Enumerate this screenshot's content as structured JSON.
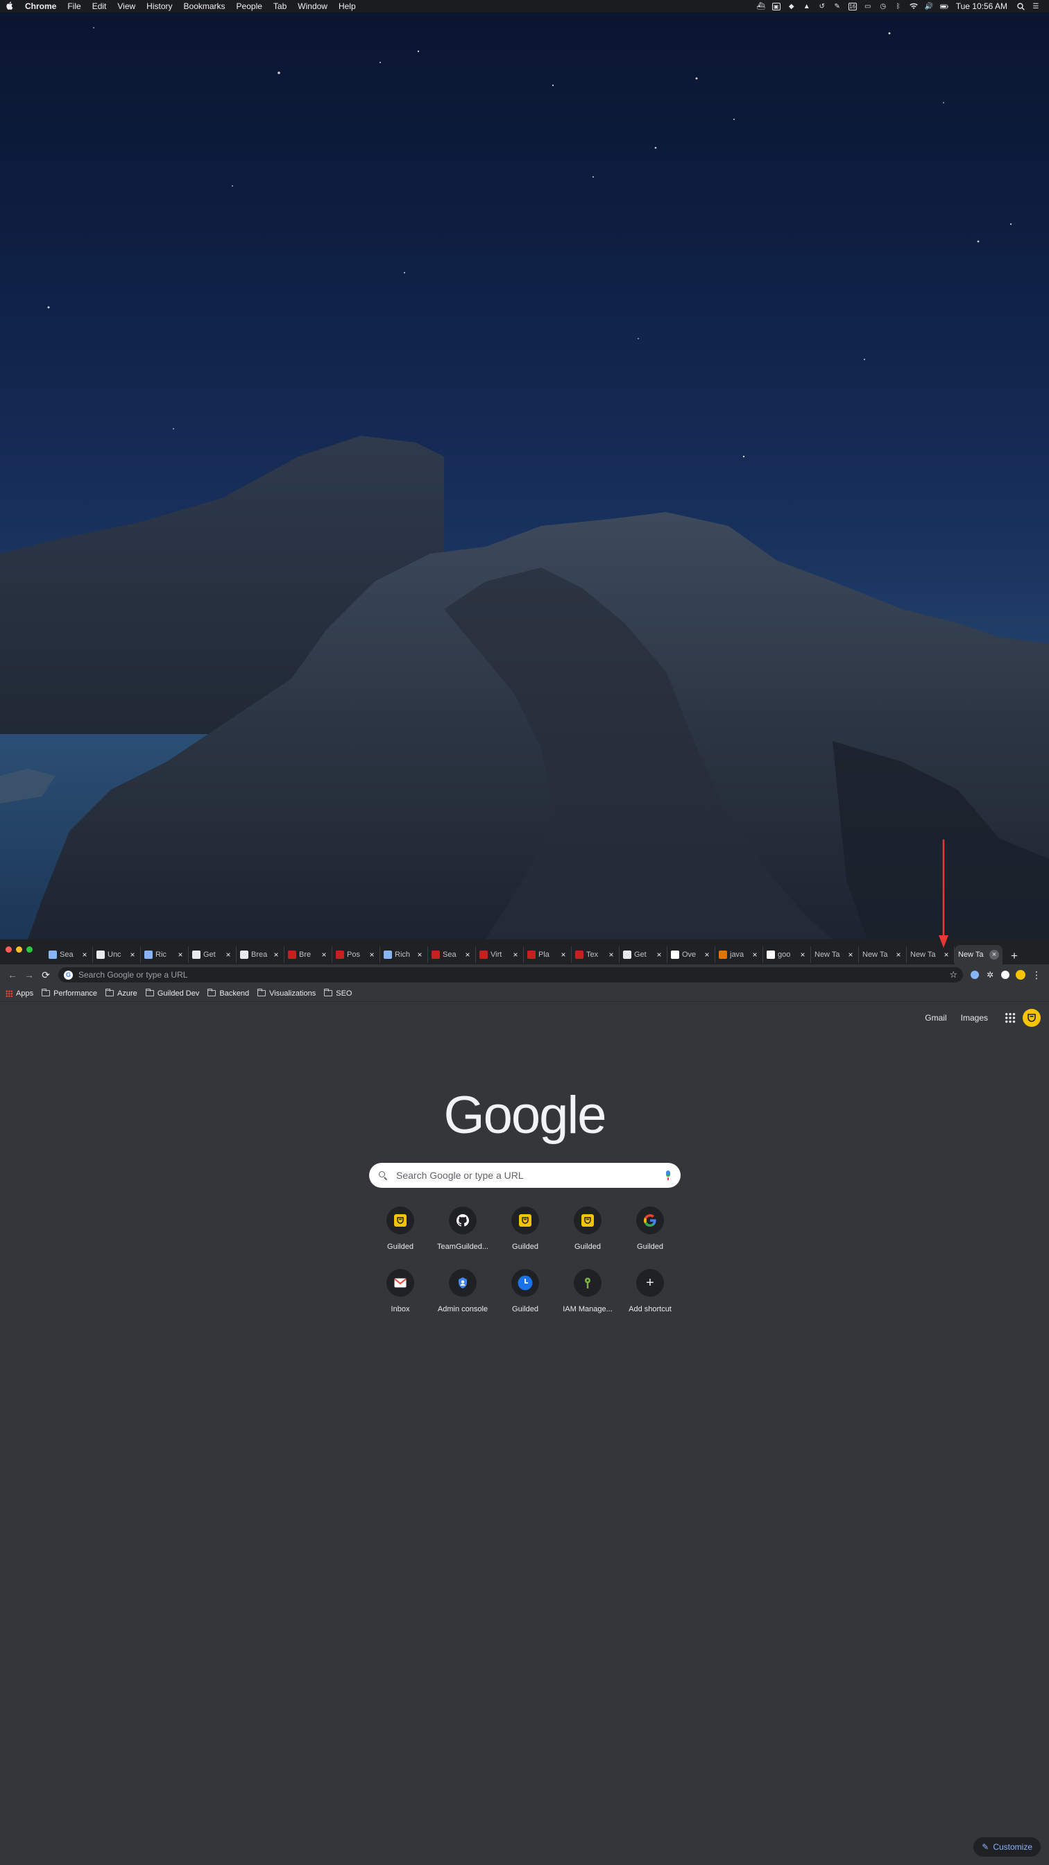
{
  "menubar": {
    "apple": "",
    "items": [
      {
        "label": "Chrome",
        "bold": true
      },
      {
        "label": "File"
      },
      {
        "label": "Edit"
      },
      {
        "label": "View"
      },
      {
        "label": "History"
      },
      {
        "label": "Bookmarks"
      },
      {
        "label": "People"
      },
      {
        "label": "Tab"
      },
      {
        "label": "Window"
      },
      {
        "label": "Help"
      }
    ],
    "status_badge": "16",
    "clock": "Tue 10:56 AM"
  },
  "tabs": [
    {
      "title": "Sea",
      "favicon": "#8ab4f8"
    },
    {
      "title": "Unc",
      "favicon": "#e8eaed"
    },
    {
      "title": "Ric",
      "favicon": "#8ab4f8"
    },
    {
      "title": "Get",
      "favicon": "#e8eaed"
    },
    {
      "title": "Brea",
      "favicon": "#e8eaed"
    },
    {
      "title": "Bre",
      "favicon": "#c5221f"
    },
    {
      "title": "Pos",
      "favicon": "#c5221f"
    },
    {
      "title": "Rich",
      "favicon": "#8ab4f8"
    },
    {
      "title": "Sea",
      "favicon": "#c5221f"
    },
    {
      "title": "Virt",
      "favicon": "#c5221f"
    },
    {
      "title": "Pla",
      "favicon": "#c5221f"
    },
    {
      "title": "Tex",
      "favicon": "#c5221f"
    },
    {
      "title": "Get",
      "favicon": "#e8eaed"
    },
    {
      "title": "Ove",
      "favicon": "#ffffff"
    },
    {
      "title": "java",
      "favicon": "#e37400"
    },
    {
      "title": "goo",
      "favicon": "#ffffff"
    },
    {
      "title": "New Ta",
      "favicon": ""
    },
    {
      "title": "New Ta",
      "favicon": ""
    },
    {
      "title": "New Ta",
      "favicon": ""
    },
    {
      "title": "New Ta",
      "favicon": "",
      "active": true
    }
  ],
  "tab_close_glyph": "×",
  "new_tab_glyph": "+",
  "toolbar": {
    "back": "←",
    "forward": "→",
    "reload": "⟳",
    "omnibox_placeholder": "Search Google or type a URL",
    "star": "☆",
    "menu": "⋮"
  },
  "bookmarks": [
    {
      "label": "Apps",
      "type": "apps"
    },
    {
      "label": "Performance",
      "type": "folder"
    },
    {
      "label": "Azure",
      "type": "folder"
    },
    {
      "label": "Guilded Dev",
      "type": "folder"
    },
    {
      "label": "Backend",
      "type": "folder"
    },
    {
      "label": "Visualizations",
      "type": "folder"
    },
    {
      "label": "SEO",
      "type": "folder"
    }
  ],
  "ntp": {
    "gmail": "Gmail",
    "images": "Images",
    "logo": "Google",
    "search_placeholder": "Search Google or type a URL",
    "shortcuts_row1": [
      {
        "label": "Guilded",
        "icon": "guilded-icon",
        "color": "#f5c400"
      },
      {
        "label": "TeamGuilded...",
        "icon": "github-icon",
        "color": "#ffffff"
      },
      {
        "label": "Guilded",
        "icon": "guilded-icon",
        "color": "#f5c400"
      },
      {
        "label": "Guilded",
        "icon": "guilded-icon",
        "color": "#f5c400"
      },
      {
        "label": "Guilded",
        "icon": "google-icon",
        "color": "#ffffff"
      }
    ],
    "shortcuts_row2": [
      {
        "label": "Inbox",
        "icon": "gmail-icon",
        "color": "#ea4335"
      },
      {
        "label": "Admin console",
        "icon": "admin-icon",
        "color": "#4285f4"
      },
      {
        "label": "Guilded",
        "icon": "clock-icon",
        "color": "#1a73e8"
      },
      {
        "label": "IAM Manage...",
        "icon": "key-icon",
        "color": "#7cb342"
      },
      {
        "label": "Add shortcut",
        "icon": "plus-icon",
        "color": "#e8eaed"
      }
    ],
    "customize": "Customize"
  },
  "colors": {
    "annotation_arrow": "#e53935"
  }
}
